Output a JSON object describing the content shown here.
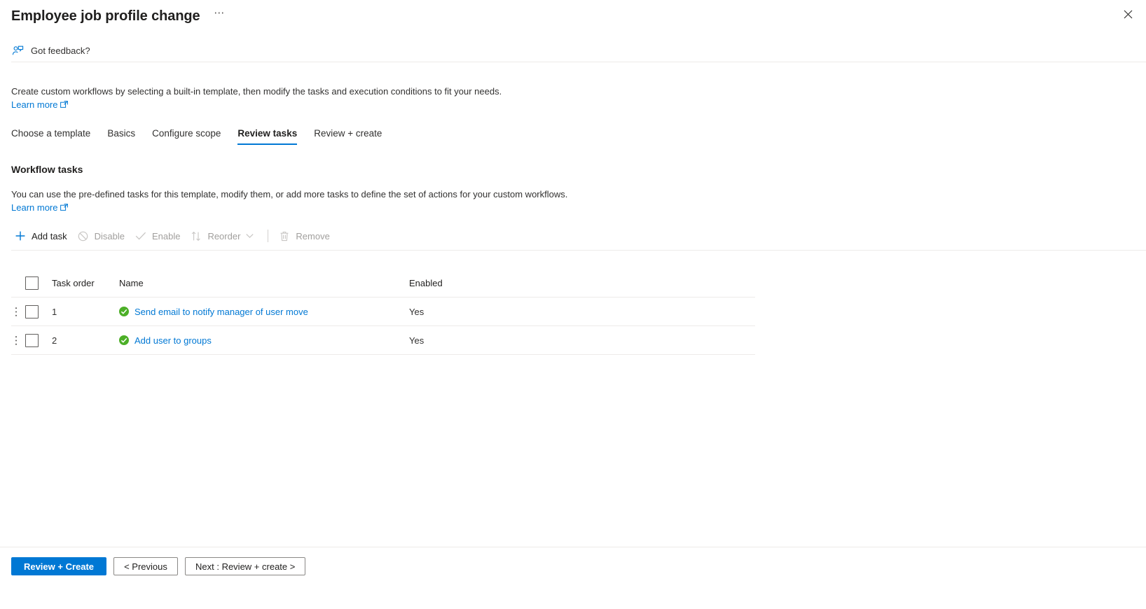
{
  "blade": {
    "title": "Employee job profile change",
    "ellipsis_label": "⋯",
    "close_icon": "close-icon"
  },
  "feedback": {
    "label": "Got feedback?",
    "icon": "feedback-person-icon"
  },
  "intro": {
    "text": "Create custom workflows by selecting a built-in template, then modify the tasks and execution conditions to fit your needs.",
    "learn_more": "Learn more"
  },
  "tabs": [
    {
      "label": "Choose a template",
      "active": false
    },
    {
      "label": "Basics",
      "active": false
    },
    {
      "label": "Configure scope",
      "active": false
    },
    {
      "label": "Review tasks",
      "active": true
    },
    {
      "label": "Review + create",
      "active": false
    }
  ],
  "section": {
    "title": "Workflow tasks",
    "description": "You can use the pre-defined tasks for this template, modify them, or add more tasks to define the set of actions for your custom workflows.",
    "learn_more": "Learn more"
  },
  "commandbar": {
    "add_task": {
      "label": "Add task",
      "icon": "plus-icon",
      "enabled": true
    },
    "disable": {
      "label": "Disable",
      "icon": "block-circle-icon",
      "enabled": false
    },
    "enable": {
      "label": "Enable",
      "icon": "checkmark-icon",
      "enabled": false
    },
    "reorder": {
      "label": "Reorder",
      "icon": "sort-arrows-icon",
      "chevron": "chevron-down-icon",
      "enabled": false
    },
    "remove": {
      "label": "Remove",
      "icon": "trash-icon",
      "enabled": false
    }
  },
  "table": {
    "columns": {
      "select_all": "select-all-checkbox",
      "task_order": "Task order",
      "name": "Name",
      "enabled": "Enabled"
    },
    "rows": [
      {
        "order": "1",
        "name": "Send email to notify manager of user move",
        "enabled": "Yes",
        "status_icon": "green-check-circle-icon"
      },
      {
        "order": "2",
        "name": "Add user to groups",
        "enabled": "Yes",
        "status_icon": "green-check-circle-icon"
      }
    ]
  },
  "footer": {
    "review_create": "Review + Create",
    "previous": "< Previous",
    "next": "Next : Review + create >"
  },
  "colors": {
    "accent": "#0078d4",
    "link": "#0078d4",
    "status_green": "#4caf27",
    "disabled_text": "#a19f9d",
    "border": "#edebe9"
  }
}
